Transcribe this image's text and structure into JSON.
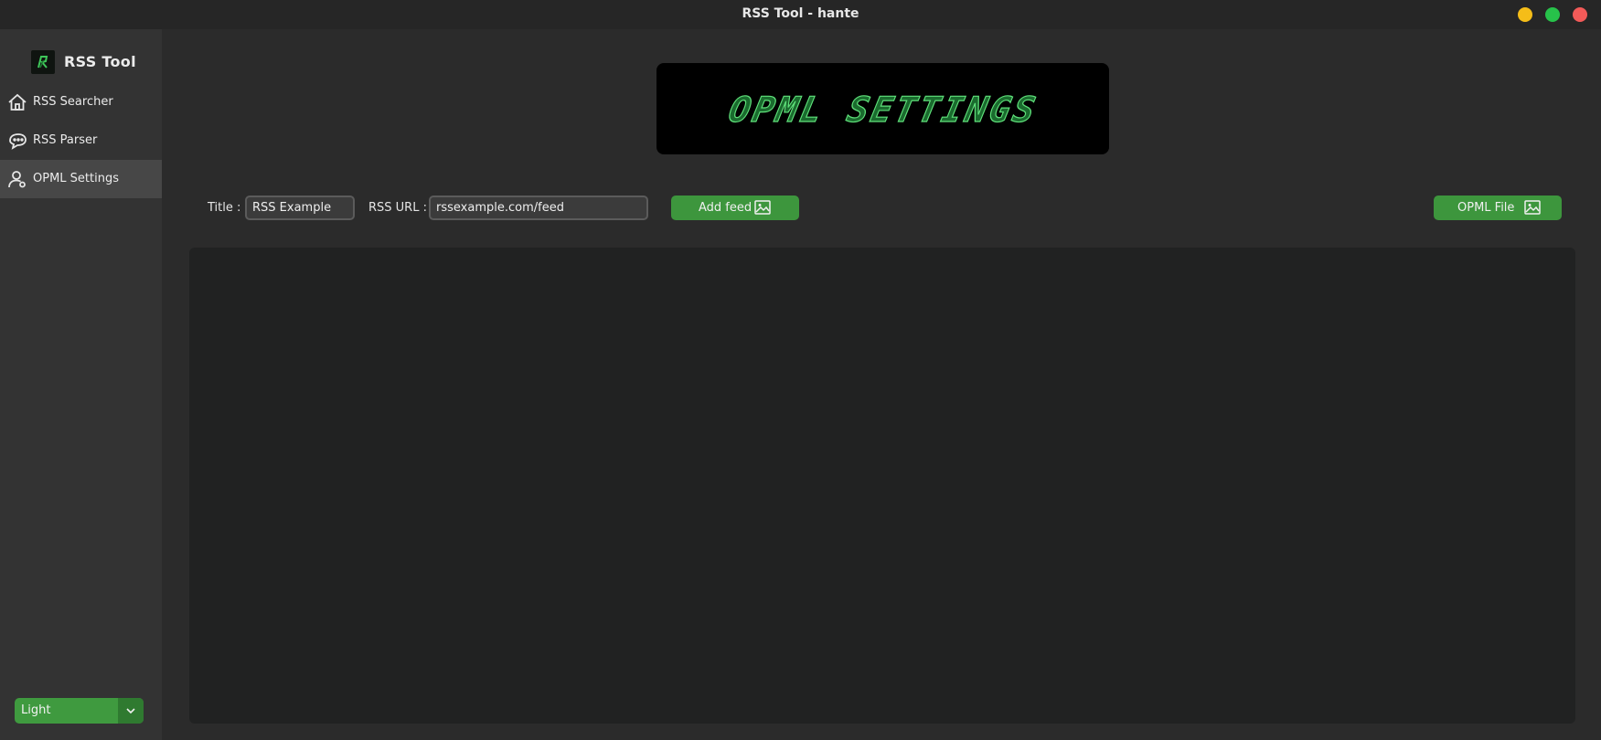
{
  "window": {
    "title": "RSS Tool - hante"
  },
  "sidebar": {
    "brand": "RSS Tool",
    "items": [
      {
        "label": "RSS Searcher",
        "icon": "home-icon",
        "active": false
      },
      {
        "label": "RSS Parser",
        "icon": "chat-icon",
        "active": false
      },
      {
        "label": "OPML Settings",
        "icon": "user-icon",
        "active": true
      }
    ],
    "theme": {
      "selected": "Light"
    }
  },
  "header": {
    "banner_text": "OPML SETTINGS"
  },
  "form": {
    "title_label": "Title :",
    "title_value": "RSS Example",
    "url_label": "RSS URL :",
    "url_value": "rssexample.com/feed",
    "add_button": "Add feed",
    "opml_button": "OPML File"
  },
  "colors": {
    "accent": "#3d963d",
    "banner_text": "#3fc75a",
    "background": "#2b2b2b",
    "sidebar": "#333333"
  }
}
